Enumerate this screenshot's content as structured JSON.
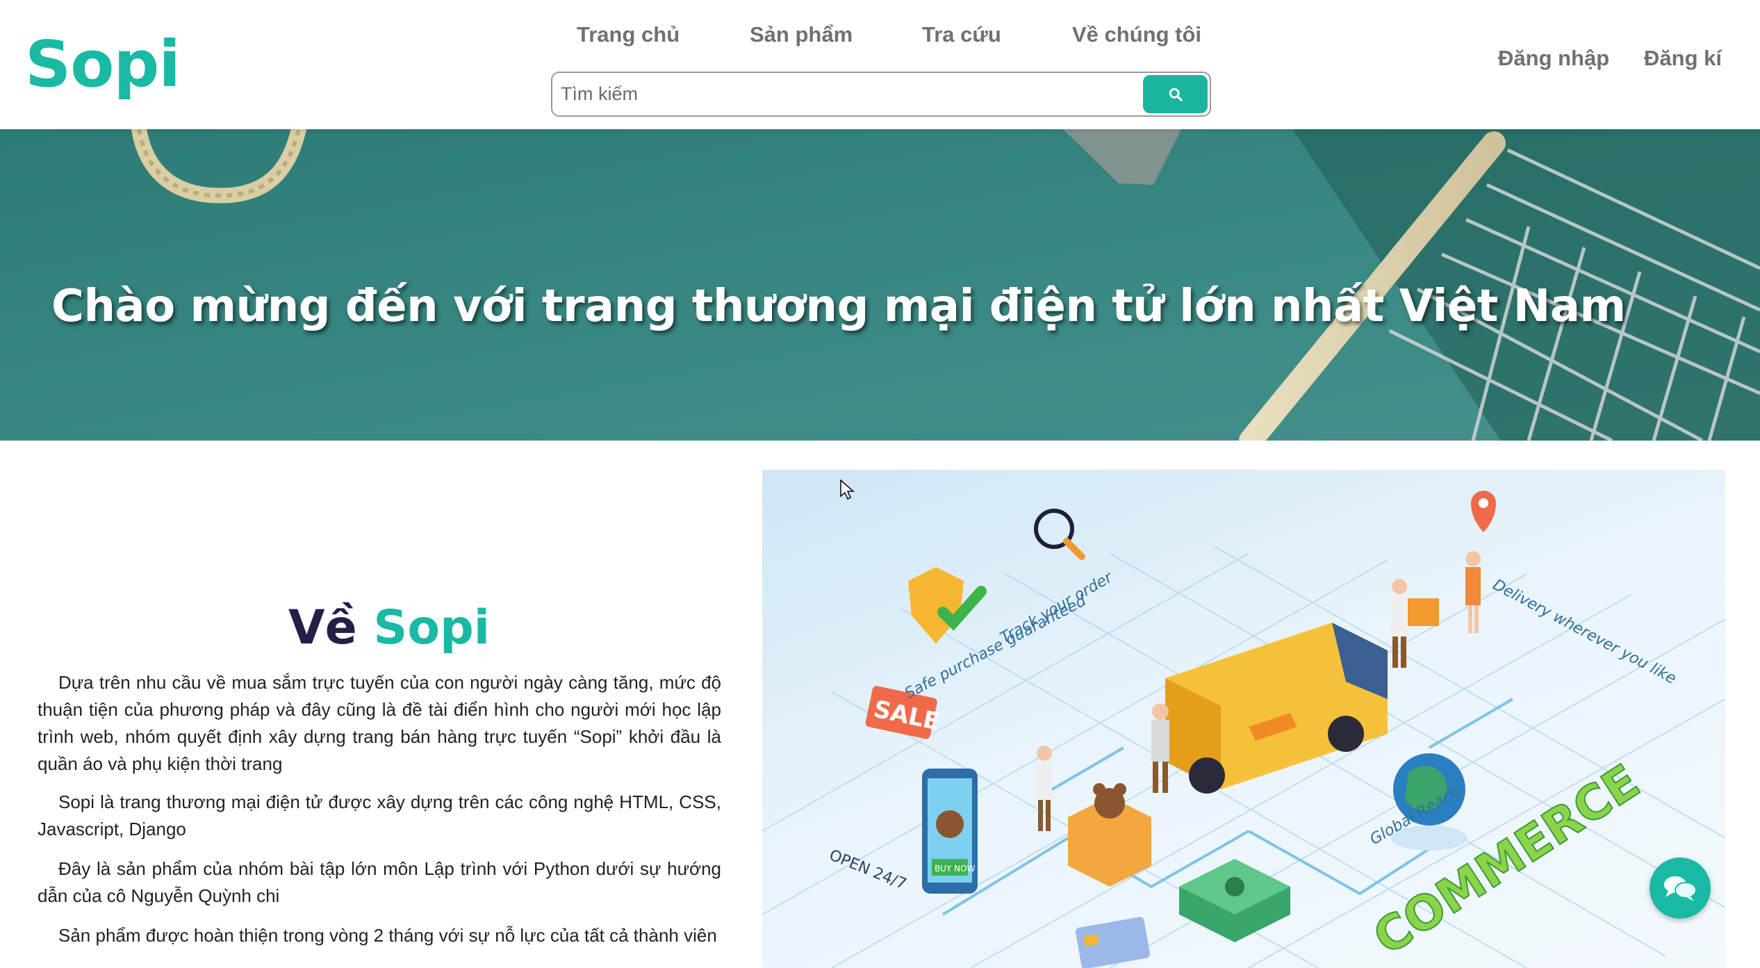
{
  "brand": {
    "logo": "Sopi",
    "color": "#1ab9a4"
  },
  "nav": {
    "items": [
      {
        "label": "Trang chủ"
      },
      {
        "label": "Sản phẩm"
      },
      {
        "label": "Tra cứu"
      },
      {
        "label": "Về chúng tôi"
      }
    ]
  },
  "search": {
    "placeholder": "Tìm kiếm",
    "value": "",
    "icon": "search-icon"
  },
  "auth": {
    "login_label": "Đăng nhập",
    "register_label": "Đăng kí"
  },
  "banner": {
    "title": "Chào mừng đến với trang thương mại điện tử lớn nhất Việt Nam"
  },
  "about": {
    "heading_prefix": "Về",
    "heading_brand": "Sopi",
    "paragraphs": [
      "Dựa trên nhu cầu về mua sắm trực tuyến của con người ngày càng tăng, mức độ thuận tiện của phương pháp và đây cũng là đề tài điển hình cho người mới học lập trình web, nhóm quyết định xây dựng trang bán hàng trực tuyến “Sopi” khởi đầu là quần áo và phụ kiện thời trang",
      "Sopi là trang thương mại điện tử được xây dựng trên các công nghệ HTML, CSS, Javascript, Django",
      "Đây là sản phẩm của nhóm bài tập lớn môn Lập trình với Python dưới sự hướng dẫn của cô Nguyễn Quỳnh chi",
      "Sản phẩm được hoàn thiện trong vòng 2 tháng với sự nỗ lực của tất cả thành viên"
    ]
  },
  "illustration": {
    "labels": {
      "sale": "SALE",
      "track": "Track your order",
      "safe": "Safe purchase guaranteed",
      "delivery": "Delivery wherever you like",
      "open": "OPEN 24/7",
      "buy": "BUY NOW",
      "global": "Global Reach",
      "commerce": "COMMERCE"
    }
  },
  "chat": {
    "icon": "chat-bubbles-icon"
  }
}
